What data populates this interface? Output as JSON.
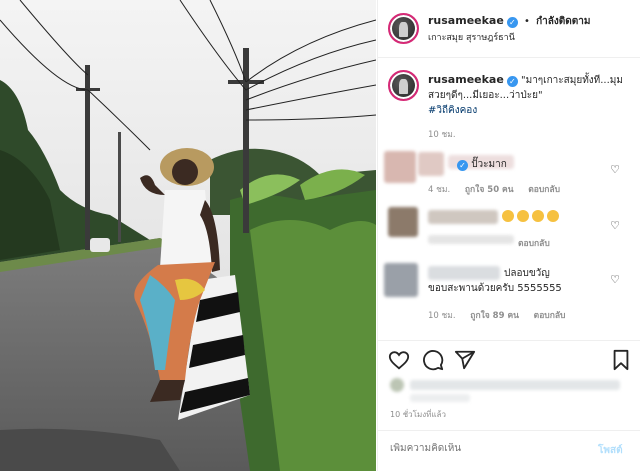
{
  "post": {
    "username": "rusameekae",
    "follow_label": "กำลังติดตาม",
    "location": "เกาะสมุย สุราษฎร์ธานี",
    "caption": "\"มาๆเกาะสมุยทั้งที...มุมสวยๆดีๆ...มีเยอะ...ว่าป่ะย\"",
    "hashtag": "#วิถีคิงคอง",
    "caption_time": "10 ชม."
  },
  "comments": [
    {
      "text": "ปั๊วะมาก",
      "time": "4 ชม.",
      "likes": "ถูกใจ 50 คน",
      "reply": "ตอบกลับ",
      "blur_color": "#d8b7b0"
    },
    {
      "text": "😄😄😄😄",
      "time": "",
      "likes": "",
      "reply": "ตอบกลับ",
      "blur_color": "#8c7a6a"
    },
    {
      "text": "ปลอบขวัญขอบสะพานด้วยครับ 5555555",
      "time": "10 ชม.",
      "likes": "ถูกใจ 89 คน",
      "reply": "ตอบกลับ",
      "blur_color": "#9aa0a8"
    }
  ],
  "footer": {
    "time_ago": "10 ชั่วโมงที่แล้ว",
    "comment_placeholder": "เพิ่มความคิดเห็น",
    "post_label": "โพสต์"
  },
  "icons": {
    "heart": "heart-icon",
    "comment": "comment-icon",
    "share": "share-icon",
    "save": "bookmark-icon"
  },
  "colors": {
    "verified": "#3897f0",
    "link": "#00376b",
    "muted": "#8e8e8e",
    "post_disabled": "#b2dffc"
  }
}
